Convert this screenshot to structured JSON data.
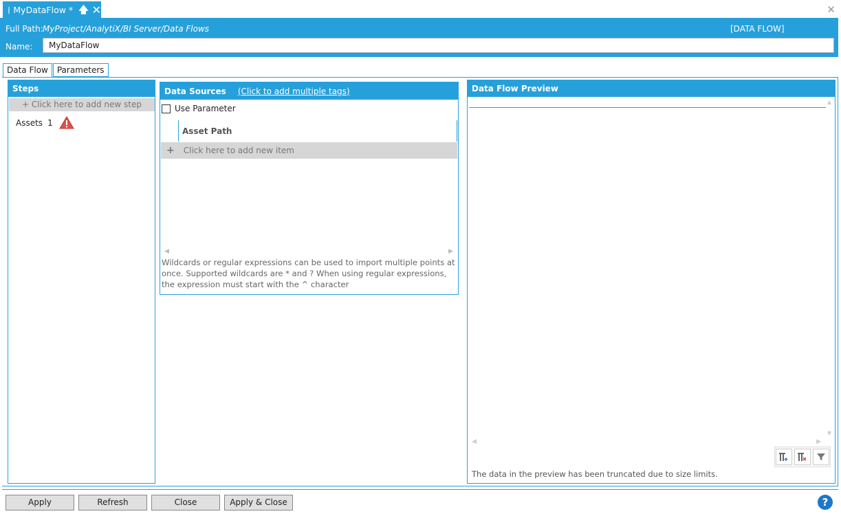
{
  "doc_tab": {
    "title": "MyDataFlow *",
    "pin_icon": "pin-icon",
    "close_icon": "close-icon"
  },
  "window": {
    "close_icon": "close-icon"
  },
  "header": {
    "path_label": "Full Path:",
    "path_value": "MyProject/AnalytiX/BI Server/Data Flows",
    "type_label": "[DATA FLOW]",
    "name_label": "Name:",
    "name_value": "MyDataFlow"
  },
  "tabs": [
    {
      "label": "Data Flow",
      "active": true
    },
    {
      "label": "Parameters",
      "active": false
    }
  ],
  "steps": {
    "title": "Steps",
    "add_label": "+ Click here to add new step",
    "items": [
      {
        "label": "Assets",
        "count": "1",
        "status_icon": "warning-icon"
      }
    ]
  },
  "sources": {
    "title": "Data Sources",
    "add_tags_link": "(Click to add multiple tags)",
    "use_parameter_label": "Use Parameter",
    "use_parameter_checked": false,
    "column_header": "Asset Path",
    "add_item_plus": "+",
    "add_item_label": "Click here to add new item",
    "help_text": "Wildcards or regular expressions can be used to import multiple points at once. Supported wildcards are * and ? When using regular expressions, the expression must start with the ^ character"
  },
  "preview": {
    "title": "Data Flow Preview",
    "truncated_note": "The data in the preview has been truncated due to size limits.",
    "tools": [
      "add-column-icon",
      "remove-column-icon",
      "filter-icon"
    ]
  },
  "footer": {
    "apply": "Apply",
    "refresh": "Refresh",
    "close": "Close",
    "apply_close": "Apply & Close",
    "help": "?"
  },
  "colors": {
    "accent": "#26a0da",
    "warning": "#d9534f",
    "help": "#1e77c8"
  }
}
